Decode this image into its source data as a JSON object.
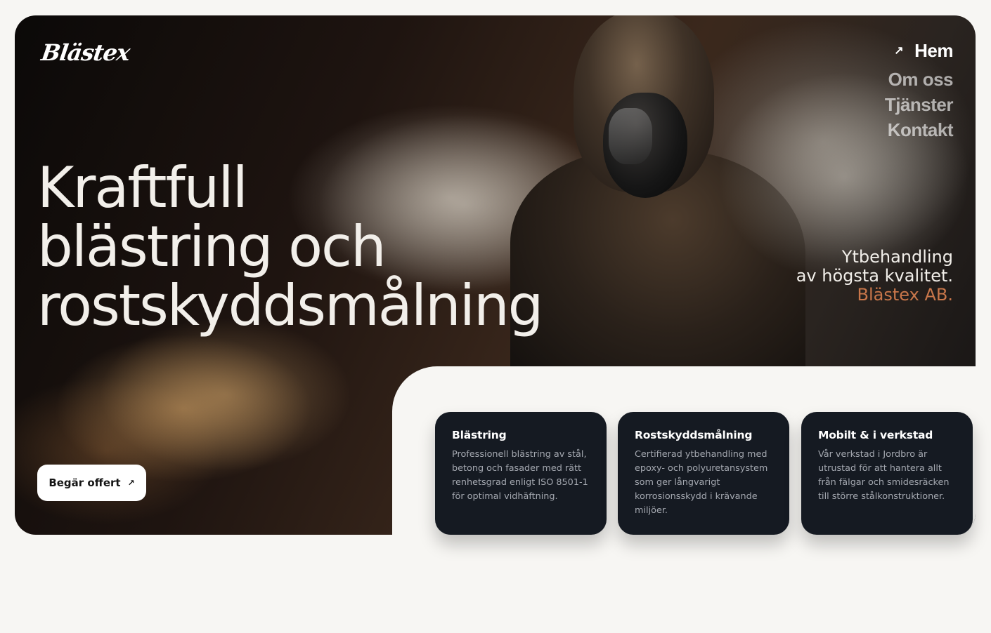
{
  "brand": {
    "logo_text": "Blästex"
  },
  "nav": {
    "items": [
      {
        "label": "Hem",
        "active": true
      },
      {
        "label": "Om oss",
        "active": false
      },
      {
        "label": "Tjänster",
        "active": false
      },
      {
        "label": "Kontakt",
        "active": false
      }
    ],
    "active_arrow_icon": "arrow-up-right-icon"
  },
  "hero": {
    "headline_lines": [
      "Kraftfull",
      "blästring och",
      "rostskyddsmålning"
    ],
    "tagline_lines": [
      "Ytbehandling",
      "av högsta kvalitet."
    ],
    "tagline_accent": "Blästex AB.",
    "cta_label": "Begär offert",
    "cta_icon": "arrow-up-right-icon"
  },
  "services": [
    {
      "title": "Blästring",
      "text": "Professionell blästring av stål, betong och fasader med rätt renhetsgrad enligt ISO 8501-1 för optimal vidhäftning."
    },
    {
      "title": "Rostskyddsmålning",
      "text": "Certifierad ytbehandling med epoxy- och polyuretansystem som ger långvarigt korrosionsskydd i krävande miljöer."
    },
    {
      "title": "Mobilt & i verkstad",
      "text": "Vår verkstad i Jordbro är utrustad för att hantera allt från fälgar och smidesräcken till större stålkonstruktioner."
    }
  ],
  "colors": {
    "accent": "#c8764a",
    "card_bg": "#151a22",
    "page_bg": "#f7f6f3"
  }
}
